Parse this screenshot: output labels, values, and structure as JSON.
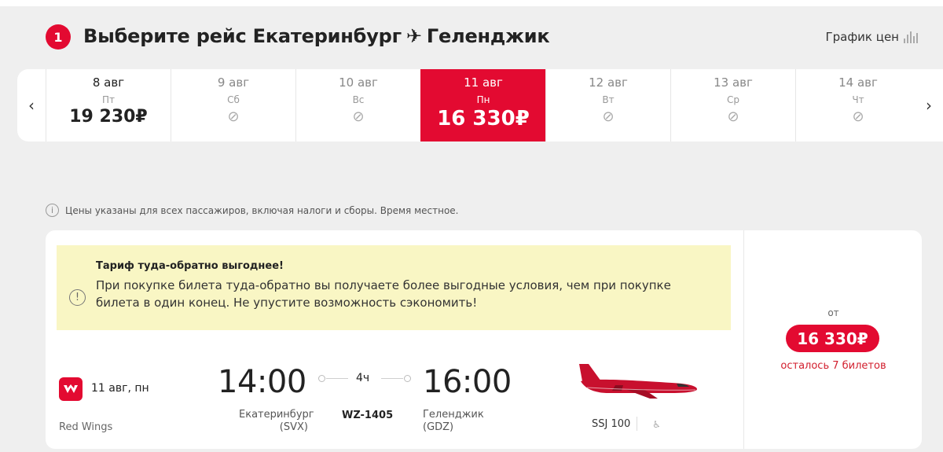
{
  "header": {
    "step": "1",
    "title_prefix": "Выберите рейс Екатеринбург",
    "title_suffix": "Геленджик",
    "chart_link": "График цен"
  },
  "dates": [
    {
      "day": "8 авг",
      "weekday": "Пт",
      "price": "19 230₽",
      "available": true
    },
    {
      "day": "9 авг",
      "weekday": "Сб",
      "price": "",
      "available": false
    },
    {
      "day": "10 авг",
      "weekday": "Вс",
      "price": "",
      "available": false
    },
    {
      "day": "11 авг",
      "weekday": "Пн",
      "price": "16 330₽",
      "available": true,
      "selected": true
    },
    {
      "day": "12 авг",
      "weekday": "Вт",
      "price": "",
      "available": false
    },
    {
      "day": "13 авг",
      "weekday": "Ср",
      "price": "",
      "available": false
    },
    {
      "day": "14 авг",
      "weekday": "Чт",
      "price": "",
      "available": false
    }
  ],
  "info": "Цены указаны для всех пассажиров, включая налоги и сборы. Время местное.",
  "notice": {
    "title": "Тариф туда-обратно выгоднее!",
    "text": "При покупке билета туда-обратно вы получаете более выгодные условия, чем при покупке билета в один конец. Не упустите возможность сэкономить!"
  },
  "flight": {
    "date": "11 авг, пн",
    "airline": "Red Wings",
    "departure_time": "14:00",
    "arrival_time": "16:00",
    "duration": "4ч",
    "departure_city": "Екатеринбург",
    "departure_code": "(SVX)",
    "arrival_city": "Геленджик",
    "arrival_code": "(GDZ)",
    "flight_number": "WZ-1405",
    "aircraft": "SSJ 100"
  },
  "price_panel": {
    "from_label": "от",
    "price": "16 330₽",
    "seats_left": "осталось 7 билетов"
  },
  "colors": {
    "accent": "#e30a31",
    "notice_bg": "#f9f6c4",
    "page_bg": "#efefef"
  }
}
